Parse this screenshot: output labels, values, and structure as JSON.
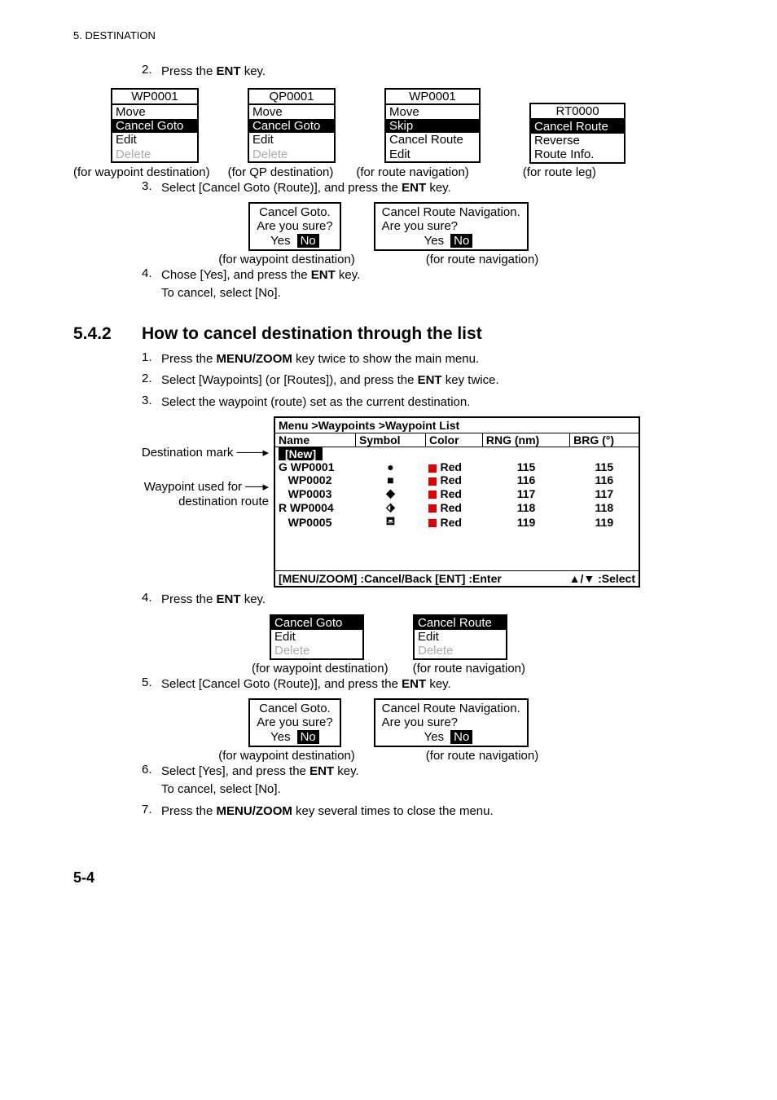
{
  "header": {
    "section": "5.  DESTINATION"
  },
  "step2": {
    "num": "2.",
    "textA": "Press the ",
    "key": "ENT",
    "textB": " key."
  },
  "fig1": {
    "boxA": {
      "title": "WP0001",
      "items": [
        {
          "label": "Move",
          "state": ""
        },
        {
          "label": "Cancel Goto",
          "state": "hl"
        },
        {
          "label": "Edit",
          "state": ""
        },
        {
          "label": "Delete",
          "state": "dim"
        }
      ]
    },
    "boxB": {
      "title": "QP0001",
      "items": [
        {
          "label": "Move",
          "state": ""
        },
        {
          "label": "Cancel Goto",
          "state": "hl"
        },
        {
          "label": "Edit",
          "state": ""
        },
        {
          "label": "Delete",
          "state": "dim"
        }
      ]
    },
    "boxC": {
      "title": "WP0001",
      "items": [
        {
          "label": "Move",
          "state": ""
        },
        {
          "label": "Skip",
          "state": "hl"
        },
        {
          "label": "Cancel Route",
          "state": ""
        },
        {
          "label": "Edit",
          "state": ""
        }
      ]
    },
    "boxD": {
      "title": "RT0000",
      "items": [
        {
          "label": "Cancel Route",
          "state": "hl"
        },
        {
          "label": "Reverse",
          "state": ""
        },
        {
          "label": "Route Info.",
          "state": ""
        }
      ]
    },
    "caps": [
      "(for waypoint destination)",
      "(for QP destination)",
      "(for route navigation)",
      "(for route leg)"
    ]
  },
  "step3": {
    "num": "3.",
    "textA": "Select [Cancel Goto (Route)], and press the ",
    "key": "ENT",
    "textB": " key."
  },
  "dlg1": {
    "a": {
      "line1": "Cancel Goto.",
      "line2": "Are you sure?",
      "yes": "Yes",
      "no": "No",
      "cap": "(for waypoint destination)"
    },
    "b": {
      "line1": "Cancel Route Navigation.",
      "line2": "Are you sure?",
      "yes": "Yes",
      "no": "No",
      "cap": "(for route navigation)"
    }
  },
  "step4": {
    "num": "4.",
    "textA": "Chose [Yes], and press the ",
    "key": "ENT",
    "textB": " key.",
    "line2": "To cancel, select [No]."
  },
  "sec542": {
    "num": "5.4.2",
    "title": "How to cancel destination through the list",
    "steps": {
      "s1": {
        "num": "1.",
        "a": "Press the ",
        "key": "MENU/ZOOM",
        "b": " key twice to show the main menu."
      },
      "s2": {
        "num": "2.",
        "a": "Select [Waypoints] (or [Routes]), and press the ",
        "key": "ENT",
        "b": " key twice."
      },
      "s3": {
        "num": "3.",
        "a": "Select the waypoint (route) set as the current destination."
      }
    }
  },
  "wp_annotations": {
    "a1": "Destination mark",
    "a2a": "Waypoint used for",
    "a2b": "destination route"
  },
  "wplist": {
    "breadcrumb": "Menu >Waypoints >Waypoint List",
    "headers": [
      "Name",
      "Symbol",
      "Color",
      "RNG (nm)",
      "BRG (°)"
    ],
    "newRow": "[New]",
    "footer": {
      "left": "[MENU/ZOOM] :Cancel/Back  [ENT] :Enter",
      "right": "▲/▼ :Select"
    }
  },
  "chart_data": {
    "type": "table",
    "rows": [
      {
        "mark": "G",
        "name": "WP0001",
        "symbol": "●",
        "color": "Red",
        "rng": 115,
        "brg": 115
      },
      {
        "mark": "",
        "name": "WP0002",
        "symbol": "■",
        "color": "Red",
        "rng": 116,
        "brg": 116
      },
      {
        "mark": "",
        "name": "WP0003",
        "symbol": "◆",
        "color": "Red",
        "rng": 117,
        "brg": 117
      },
      {
        "mark": "R",
        "name": "WP0004",
        "symbol": "⬗",
        "color": "Red",
        "rng": 118,
        "brg": 118
      },
      {
        "mark": "",
        "name": "WP0005",
        "symbol": "⛾",
        "color": "Red",
        "rng": 119,
        "brg": 119
      }
    ]
  },
  "sec542b": {
    "s4": {
      "num": "4.",
      "a": "Press the ",
      "key": "ENT",
      "b": " key."
    },
    "boxA": {
      "items": [
        {
          "label": "Cancel Goto",
          "state": "hl"
        },
        {
          "label": "Edit",
          "state": ""
        },
        {
          "label": "Delete",
          "state": "dim"
        }
      ]
    },
    "boxB": {
      "items": [
        {
          "label": "Cancel Route",
          "state": "hl"
        },
        {
          "label": "Edit",
          "state": ""
        },
        {
          "label": "Delete",
          "state": "dim"
        }
      ]
    },
    "caps": [
      "(for waypoint destination)",
      "(for route navigation)"
    ],
    "s5": {
      "num": "5.",
      "a": "Select [Cancel Goto (Route)], and press the ",
      "key": "ENT",
      "b": " key."
    },
    "dlgA": {
      "l1": "Cancel Goto.",
      "l2": "Are you sure?",
      "yes": "Yes",
      "no": "No"
    },
    "dlgB": {
      "l1": "Cancel Route Navigation.",
      "l2": "Are you sure?",
      "yes": "Yes",
      "no": "No"
    },
    "dcaps": [
      "(for waypoint destination)",
      "(for route navigation)"
    ],
    "s6": {
      "num": "6.",
      "a": "Select [Yes], and press the ",
      "key": "ENT",
      "b": " key.",
      "line2": "To cancel, select [No]."
    },
    "s7": {
      "num": "7.",
      "a": "Press the ",
      "key": "MENU/ZOOM",
      "b": " key several times to close the menu."
    }
  },
  "pagenum": "5-4"
}
